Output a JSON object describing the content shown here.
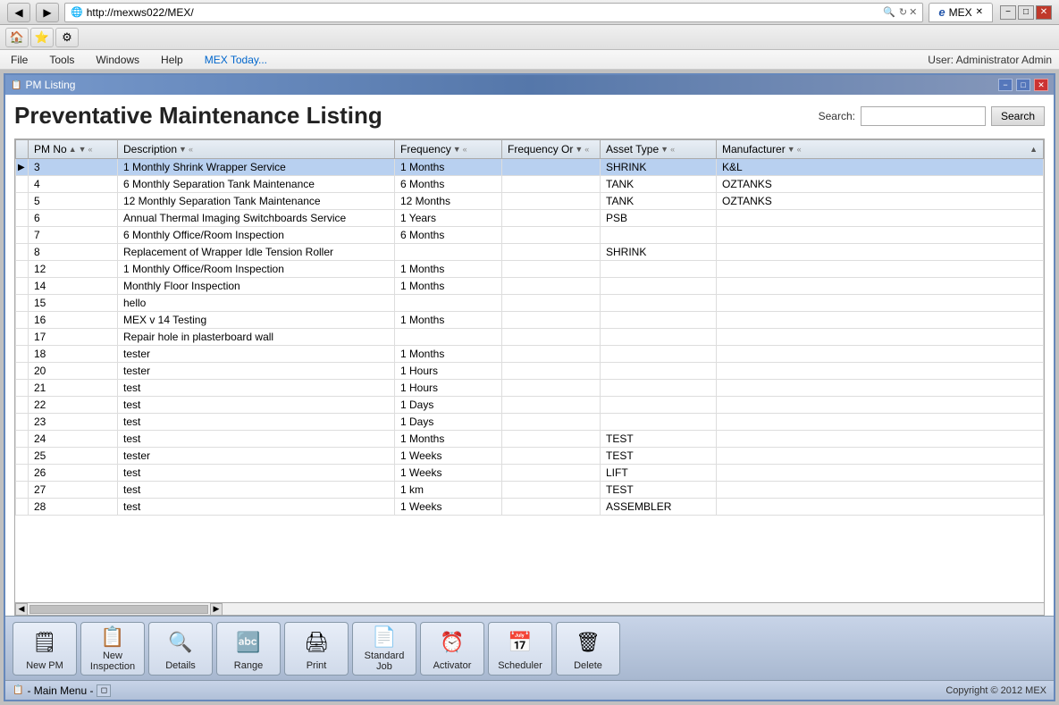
{
  "browser": {
    "url": "http://mexws022/MEX/",
    "tab_label": "MEX",
    "controls": {
      "minimize": "−",
      "maximize": "□",
      "close": "✕"
    },
    "nav": {
      "back": "◀",
      "forward": "▶",
      "refresh": "↻",
      "search_placeholder": ""
    }
  },
  "menubar": {
    "items": [
      "File",
      "Tools",
      "Windows",
      "Help",
      "MEX Today..."
    ],
    "user": "User: Administrator Admin"
  },
  "window": {
    "title": "PM Listing",
    "controls": {
      "minimize": "−",
      "maximize": "□",
      "close": "✕"
    }
  },
  "page": {
    "title": "Preventative Maintenance Listing",
    "search_label": "Search:",
    "search_value": "",
    "search_btn": "Search"
  },
  "table": {
    "columns": [
      {
        "id": "indicator",
        "label": "",
        "sortable": false
      },
      {
        "id": "pm_no",
        "label": "PM No",
        "sortable": true
      },
      {
        "id": "description",
        "label": "Description",
        "sortable": true
      },
      {
        "id": "frequency",
        "label": "Frequency",
        "sortable": true
      },
      {
        "id": "frequency_or",
        "label": "Frequency Or",
        "sortable": true
      },
      {
        "id": "asset_type",
        "label": "Asset Type",
        "sortable": true
      },
      {
        "id": "manufacturer",
        "label": "Manufacturer",
        "sortable": true
      }
    ],
    "rows": [
      {
        "pm_no": "3",
        "description": "1 Monthly Shrink Wrapper Service",
        "frequency": "1 Months",
        "frequency_or": "",
        "asset_type": "SHRINK",
        "manufacturer": "K&L",
        "selected": true
      },
      {
        "pm_no": "4",
        "description": "6 Monthly Separation Tank Maintenance",
        "frequency": "6 Months",
        "frequency_or": "",
        "asset_type": "TANK",
        "manufacturer": "OZTANKS",
        "selected": false
      },
      {
        "pm_no": "5",
        "description": "12 Monthly Separation Tank Maintenance",
        "frequency": "12 Months",
        "frequency_or": "",
        "asset_type": "TANK",
        "manufacturer": "OZTANKS",
        "selected": false
      },
      {
        "pm_no": "6",
        "description": "Annual Thermal Imaging Switchboards Service",
        "frequency": "1 Years",
        "frequency_or": "",
        "asset_type": "PSB",
        "manufacturer": "",
        "selected": false
      },
      {
        "pm_no": "7",
        "description": "6 Monthly Office/Room Inspection",
        "frequency": "6 Months",
        "frequency_or": "",
        "asset_type": "",
        "manufacturer": "",
        "selected": false
      },
      {
        "pm_no": "8",
        "description": "Replacement of Wrapper Idle Tension Roller",
        "frequency": "",
        "frequency_or": "",
        "asset_type": "SHRINK",
        "manufacturer": "",
        "selected": false
      },
      {
        "pm_no": "12",
        "description": "1 Monthly Office/Room Inspection",
        "frequency": "1 Months",
        "frequency_or": "",
        "asset_type": "",
        "manufacturer": "",
        "selected": false
      },
      {
        "pm_no": "14",
        "description": "Monthly Floor Inspection",
        "frequency": "1 Months",
        "frequency_or": "",
        "asset_type": "",
        "manufacturer": "",
        "selected": false
      },
      {
        "pm_no": "15",
        "description": "hello",
        "frequency": "",
        "frequency_or": "",
        "asset_type": "",
        "manufacturer": "",
        "selected": false
      },
      {
        "pm_no": "16",
        "description": "MEX v 14 Testing",
        "frequency": "1 Months",
        "frequency_or": "",
        "asset_type": "",
        "manufacturer": "",
        "selected": false
      },
      {
        "pm_no": "17",
        "description": "Repair hole in plasterboard wall",
        "frequency": "",
        "frequency_or": "",
        "asset_type": "",
        "manufacturer": "",
        "selected": false
      },
      {
        "pm_no": "18",
        "description": "tester",
        "frequency": "1 Months",
        "frequency_or": "",
        "asset_type": "",
        "manufacturer": "",
        "selected": false
      },
      {
        "pm_no": "20",
        "description": "tester",
        "frequency": "1 Hours",
        "frequency_or": "",
        "asset_type": "",
        "manufacturer": "",
        "selected": false
      },
      {
        "pm_no": "21",
        "description": "test",
        "frequency": "1 Hours",
        "frequency_or": "",
        "asset_type": "",
        "manufacturer": "",
        "selected": false
      },
      {
        "pm_no": "22",
        "description": "test",
        "frequency": "1 Days",
        "frequency_or": "",
        "asset_type": "",
        "manufacturer": "",
        "selected": false
      },
      {
        "pm_no": "23",
        "description": "test",
        "frequency": "1 Days",
        "frequency_or": "",
        "asset_type": "",
        "manufacturer": "",
        "selected": false
      },
      {
        "pm_no": "24",
        "description": "test",
        "frequency": "1 Months",
        "frequency_or": "",
        "asset_type": "TEST",
        "manufacturer": "",
        "selected": false
      },
      {
        "pm_no": "25",
        "description": "tester",
        "frequency": "1 Weeks",
        "frequency_or": "",
        "asset_type": "TEST",
        "manufacturer": "",
        "selected": false
      },
      {
        "pm_no": "26",
        "description": "test",
        "frequency": "1 Weeks",
        "frequency_or": "",
        "asset_type": "LIFT",
        "manufacturer": "",
        "selected": false
      },
      {
        "pm_no": "27",
        "description": "test",
        "frequency": "1 km",
        "frequency_or": "",
        "asset_type": "TEST",
        "manufacturer": "",
        "selected": false
      },
      {
        "pm_no": "28",
        "description": "test",
        "frequency": "1 Weeks",
        "frequency_or": "",
        "asset_type": "ASSEMBLER",
        "manufacturer": "",
        "selected": false
      }
    ]
  },
  "toolbar": {
    "buttons": [
      {
        "id": "new-pm",
        "label": "New PM",
        "icon": "🗒"
      },
      {
        "id": "new-inspection",
        "label": "New Inspection",
        "icon": "📋"
      },
      {
        "id": "details",
        "label": "Details",
        "icon": "🔍"
      },
      {
        "id": "range",
        "label": "Range",
        "icon": "🔤"
      },
      {
        "id": "print",
        "label": "Print",
        "icon": "🖨"
      },
      {
        "id": "standard-job",
        "label": "Standard Job",
        "icon": "📄"
      },
      {
        "id": "activator",
        "label": "Activator",
        "icon": "⏰"
      },
      {
        "id": "scheduler",
        "label": "Scheduler",
        "icon": "📅"
      },
      {
        "id": "delete",
        "label": "Delete",
        "icon": "🗑"
      }
    ]
  },
  "statusbar": {
    "main_menu": "- Main Menu -",
    "copyright": "Copyright © 2012 MEX"
  }
}
